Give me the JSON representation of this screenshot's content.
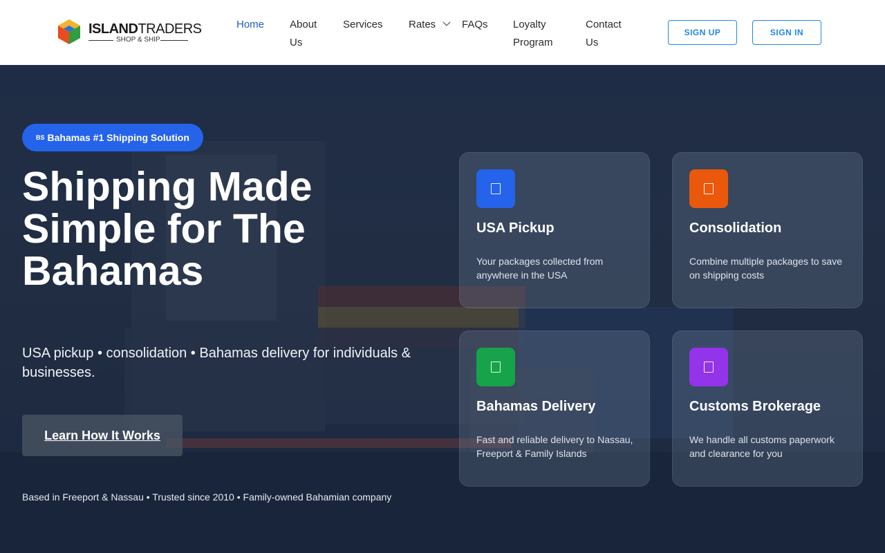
{
  "header": {
    "logo": {
      "word_bold": "ISLAND",
      "word_regular": "TRADERS",
      "tagline": "SHOP & SHIP",
      "cube_colors": [
        "#f2b32e",
        "#e84c1f",
        "#2e9e3e",
        "#2f6fd6"
      ]
    },
    "nav": [
      {
        "label": "Home",
        "active": true
      },
      {
        "label": "About\nUs",
        "active": false
      },
      {
        "label": "Services",
        "active": false
      },
      {
        "label": "Rates",
        "active": false,
        "has_dropdown": true,
        "icon": "chevron-down-icon"
      },
      {
        "label": "FAQs",
        "active": false
      },
      {
        "label": "Loyalty\nProgram",
        "active": false
      },
      {
        "label": "Contact\nUs",
        "active": false
      }
    ],
    "buttons": {
      "signup": "SIGN UP",
      "signin": "SIGN IN"
    },
    "accent_color": "#1e88e5"
  },
  "hero": {
    "badge": {
      "flag": "BS",
      "text": "Bahamas #1 Shipping Solution",
      "color": "#2563eb"
    },
    "headline": "Shipping Made Simple for The Bahamas",
    "subline": "USA pickup • consolidation • Bahamas delivery for individuals & businesses.",
    "cta": "Learn How It Works",
    "footnote": "Based in Freeport & Nassau • Trusted since 2010 • Family-owned Bahamian company",
    "cards": [
      {
        "title": "USA Pickup",
        "desc": "Your packages collected from anywhere in the USA",
        "color": "#2563eb",
        "icon": "package-icon"
      },
      {
        "title": "Consolidation",
        "desc": "Combine multiple packages to save on shipping costs",
        "color": "#ea580c",
        "icon": "boxes-icon"
      },
      {
        "title": "Bahamas Delivery",
        "desc": "Fast and reliable delivery to Nassau, Freeport & Family Islands",
        "color": "#16a34a",
        "icon": "truck-icon"
      },
      {
        "title": "Customs Brokerage",
        "desc": "We handle all customs paperwork and clearance for you",
        "color": "#9333ea",
        "icon": "document-icon"
      }
    ]
  }
}
